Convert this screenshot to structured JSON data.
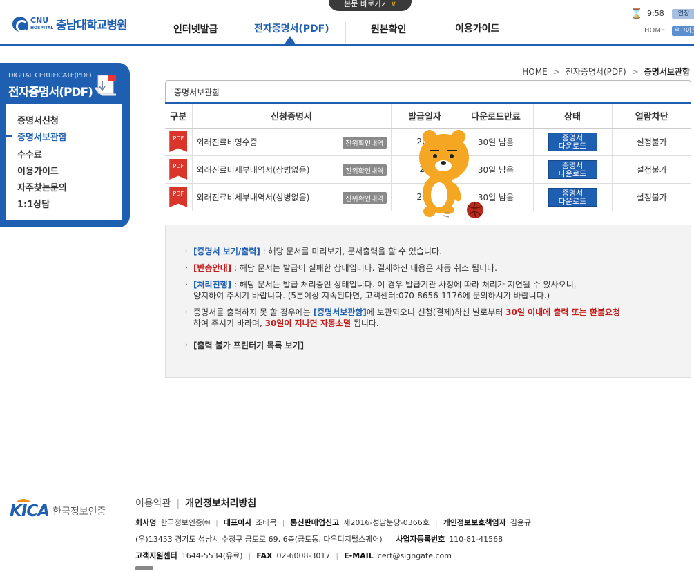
{
  "header": {
    "logo_en": "CNU",
    "logo_en_sub": "HOSPITAL",
    "logo_ko": "충남대학교병원",
    "shortcut": "본문 바로가기",
    "nav": [
      "인터넷발급",
      "전자증명서(PDF)",
      "원본확인",
      "이용가이드"
    ],
    "time": "9:58",
    "extend": "연장",
    "home": "HOME",
    "logout": "로그아웃"
  },
  "sidebar": {
    "en": "DIGITAL CERTIFICATE(PDF)",
    "title": "전자증명서(PDF)",
    "items": [
      "증명서신청",
      "증명서보관함",
      "수수료",
      "이용가이드",
      "자주찾는문의",
      "1:1상담"
    ]
  },
  "breadcrumb": [
    "HOME",
    "전자증명서(PDF)",
    "증명서보관함"
  ],
  "section_title": "증명서보관함",
  "table": {
    "headers": [
      "구분",
      "신청증명서",
      "발급일자",
      "다운로드만료",
      "상태",
      "열람차단"
    ],
    "pdf_label": "PDF",
    "verify_label": "진위확인내역",
    "download_label_1": "증명서",
    "download_label_2": "다운로드",
    "rows": [
      {
        "name": "외래진료비영수증",
        "date": "202",
        "expire": "30일 남음",
        "block": "설정불가"
      },
      {
        "name": "외래진료비세부내역서(상병없음)",
        "date": "20",
        "expire": "30일 남음",
        "block": "설정불가"
      },
      {
        "name": "외래진료비세부내역서(상병없음)",
        "date": "202",
        "expire": "30일 남음",
        "block": "설정불가"
      }
    ]
  },
  "info": {
    "l1_kw": "[증명서 보기/출력]",
    "l1_text": " : 해당 문서를 미리보기, 문서출력을 할 수 있습니다.",
    "l2_kw": "[반송안내]",
    "l2_text": " : 해당 문서는 발급이 실패한 상태입니다. 결제하신 내용은 자동 취소 됩니다.",
    "l3_kw": "[처리진행]",
    "l3_text": " : 해당 문서는 발급 처리중인 상태입니다. 이 경우 발급기관 사정에 따라 처리가 지연될 수 있사오니,",
    "l3_text2": "양지하여 주시기 바랍니다. (5분이상 지속된다면, 고객센터:070-8656-1176에 문의하시기 바랍니다.)",
    "l4_a": "증명서를 출력하지 못 할 경우에는 ",
    "l4_kw": "[증명서보관함]",
    "l4_b": "에 보관되오니 신청(결제)하신 날로부터 ",
    "l4_red": "30일 이내에 출력 또는 환불요청",
    "l4_c": "하여 주시기 바라며, ",
    "l4_red2": "30일이 지나면 자동소멸",
    "l4_d": " 됩니다.",
    "l5": "[출력 불가 프린터기 목록 보기]"
  },
  "footer": {
    "logo_mark": "KICA",
    "logo_ko": "한국정보인증",
    "link1": "이용약관",
    "link2": "개인정보처리방침",
    "company_label": "회사명",
    "company": "한국정보인증㈜",
    "ceo_label": "대표이사",
    "ceo": "조태묵",
    "telecom_label": "통신판매업신고",
    "telecom": "제2016-성남분당-0366호",
    "privacy_label": "개인정보보호책임자",
    "privacy": "김윤규",
    "address": "(우)13453 경기도 성남시 수정구 금토로 69, 6층(금토동, 다우디지털스퀘어)",
    "bizno_label": "사업자등록번호",
    "bizno": "110-81-41568",
    "cs_label": "고객지원센터",
    "cs": "1644-5534(유료)",
    "fax_label": "FAX",
    "fax": "02-6008-3017",
    "email_label": "E-MAIL",
    "email": "cert@signgate.com"
  }
}
